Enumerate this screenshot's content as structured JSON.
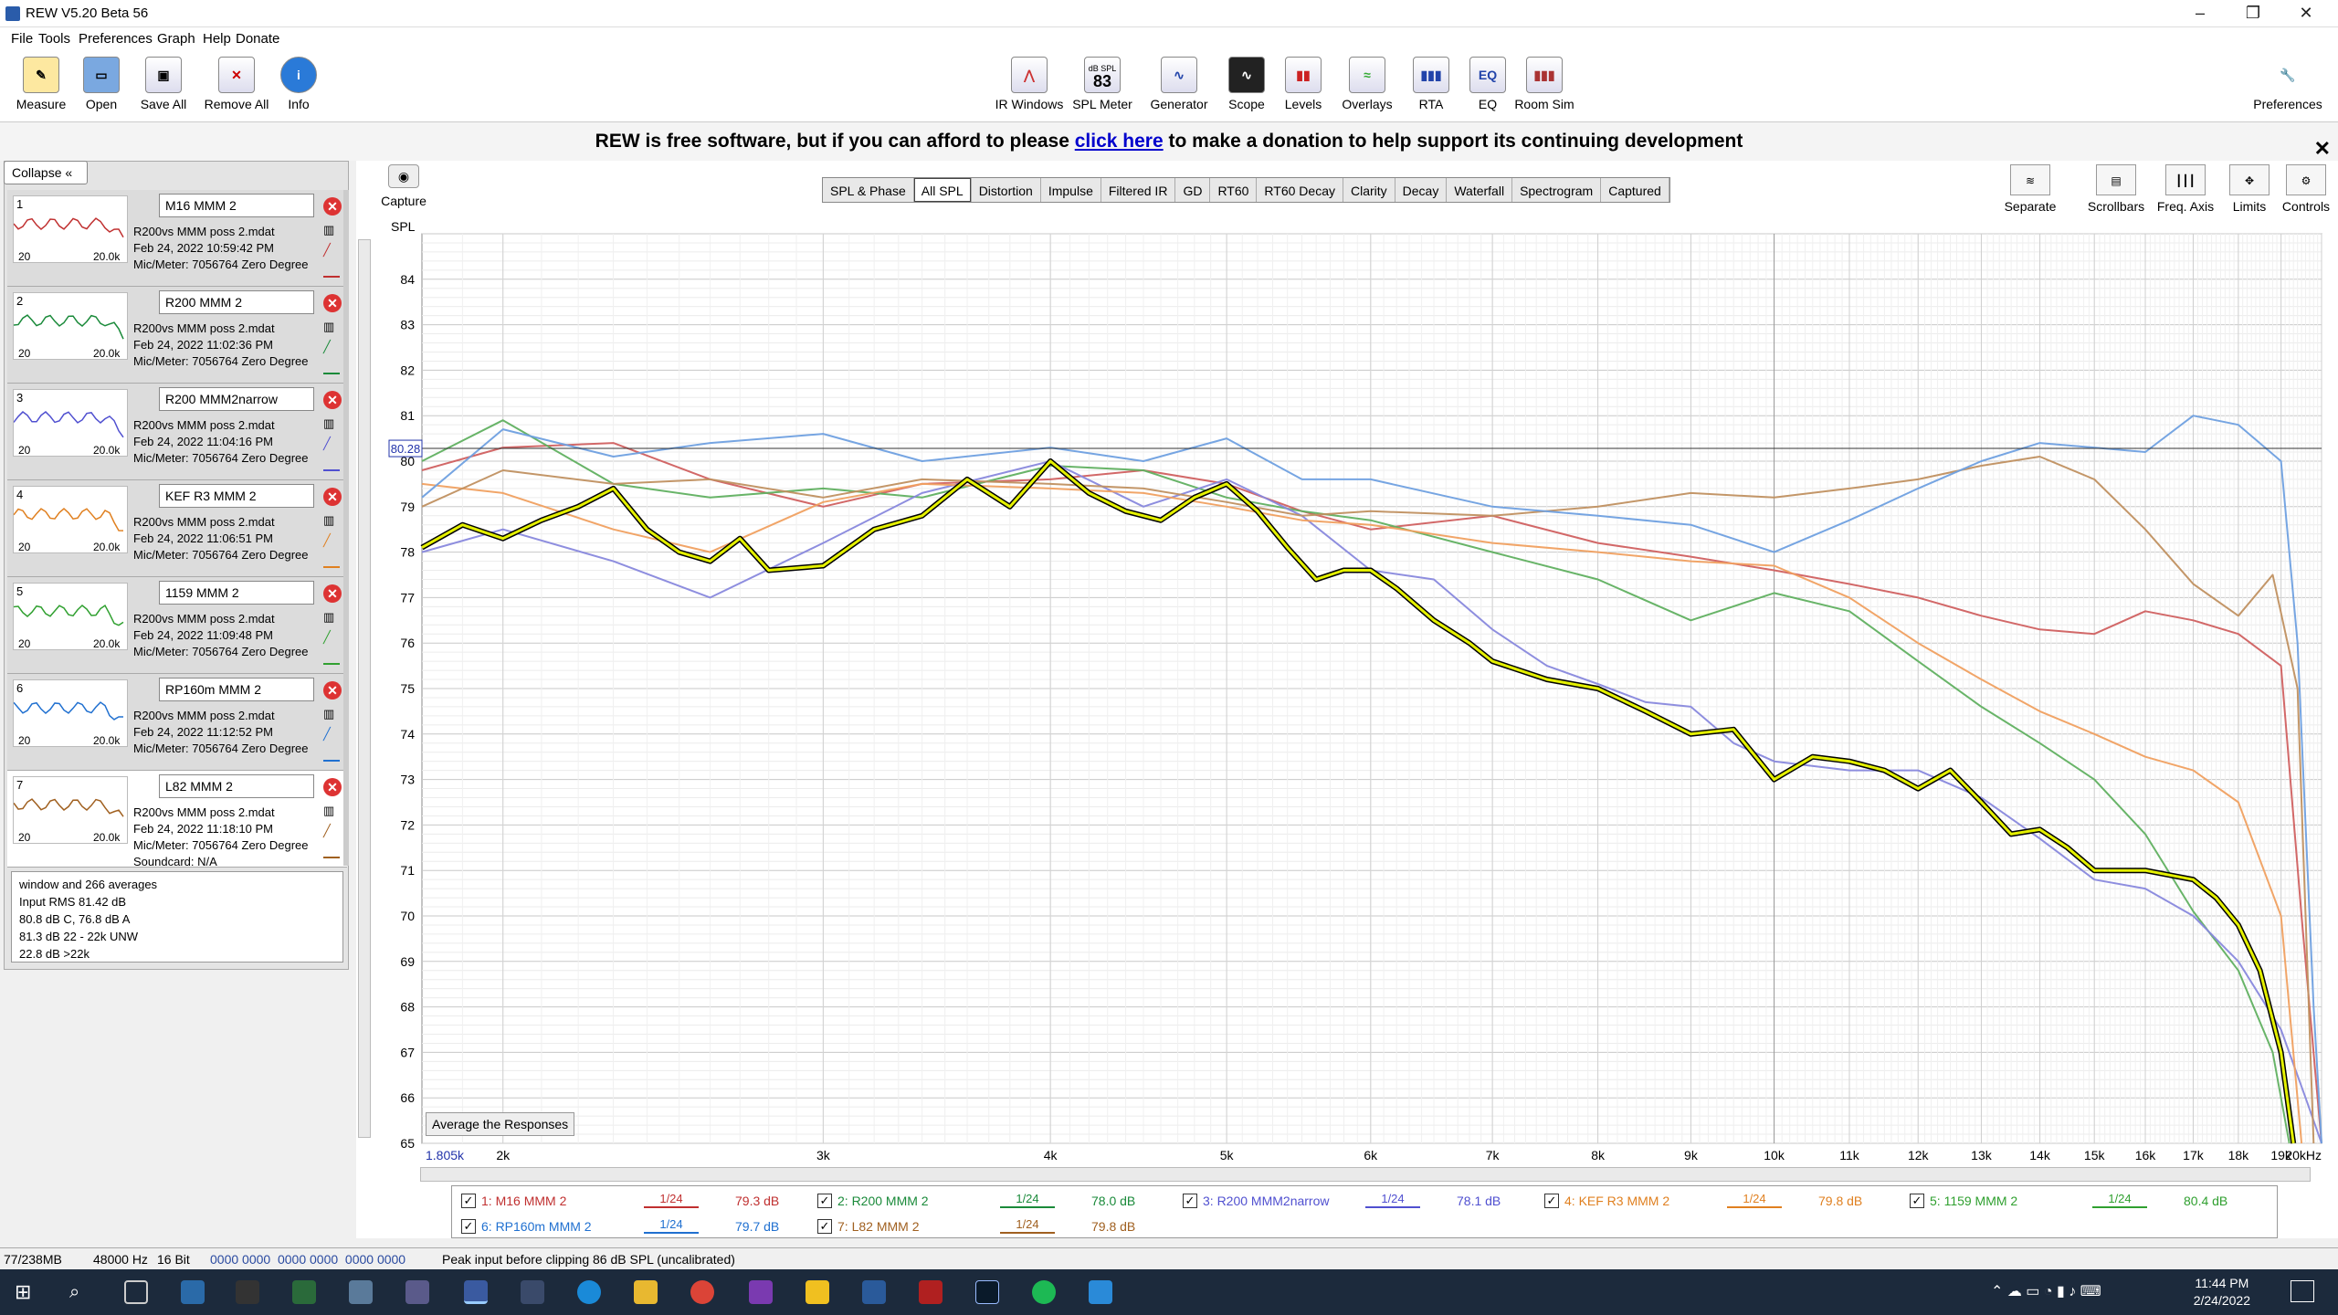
{
  "app": {
    "title": "REW V5.20 Beta 56"
  },
  "menu": [
    "File",
    "Tools",
    "Preferences",
    "Graph",
    "Help",
    "Donate"
  ],
  "toolbar_left": [
    "Measure",
    "Open",
    "Save All",
    "Remove All",
    "Info"
  ],
  "toolbar_center": [
    "IR Windows",
    "SPL Meter",
    "Generator",
    "Scope",
    "Levels",
    "Overlays",
    "RTA",
    "EQ",
    "Room Sim"
  ],
  "spl_meter_badge": {
    "top": "dB SPL",
    "value": "83"
  },
  "preferences_label": "Preferences",
  "banner": {
    "pre": "REW is free software, but if you can afford to please ",
    "link": "click here",
    "post": " to make a donation to help support its continuing development"
  },
  "collapse_label": "Collapse",
  "measurements": [
    {
      "num": "1",
      "name": "M16 MMM 2",
      "file": "R200vs MMM poss 2.mdat",
      "date": "Feb 24, 2022 10:59:42 PM",
      "mic": "Mic/Meter: 7056764 Zero Degree",
      "color": "#c03030"
    },
    {
      "num": "2",
      "name": "R200 MMM 2",
      "file": "R200vs MMM poss 2.mdat",
      "date": "Feb 24, 2022 11:02:36 PM",
      "mic": "Mic/Meter: 7056764 Zero Degree",
      "color": "#1a8a3a"
    },
    {
      "num": "3",
      "name": "R200 MMM2narrow",
      "file": "R200vs MMM poss 2.mdat",
      "date": "Feb 24, 2022 11:04:16 PM",
      "mic": "Mic/Meter: 7056764 Zero Degree",
      "color": "#5050d0"
    },
    {
      "num": "4",
      "name": "KEF R3 MMM 2",
      "file": "R200vs MMM poss 2.mdat",
      "date": "Feb 24, 2022 11:06:51 PM",
      "mic": "Mic/Meter: 7056764 Zero Degree",
      "color": "#e08020"
    },
    {
      "num": "5",
      "name": "1159 MMM 2",
      "file": "R200vs MMM poss 2.mdat",
      "date": "Feb 24, 2022 11:09:48 PM",
      "mic": "Mic/Meter: 7056764 Zero Degree",
      "color": "#30a030"
    },
    {
      "num": "6",
      "name": "RP160m MMM 2",
      "file": "R200vs MMM poss 2.mdat",
      "date": "Feb 24, 2022 11:12:52 PM",
      "mic": "Mic/Meter: 7056764 Zero Degree",
      "color": "#2070d0"
    },
    {
      "num": "7",
      "name": "L82 MMM 2",
      "file": "R200vs MMM poss 2.mdat",
      "date": "Feb 24, 2022 11:18:10 PM",
      "mic": "Mic/Meter: 7056764 Zero Degree",
      "color": "#a06020"
    }
  ],
  "thumb_axis": {
    "min": "20",
    "max": "20.0k"
  },
  "soundcard_line": "Soundcard: N/A",
  "info_lines": [
    "window and 266 averages",
    "Input RMS 81.42 dB",
    "80.8 dB C, 76.8 dB A",
    "81.3 dB 22 - 22k UNW",
    "22.8 dB >22k"
  ],
  "capture_label": "Capture",
  "graph_tabs": [
    "SPL & Phase",
    "All SPL",
    "Distortion",
    "Impulse",
    "Filtered IR",
    "GD",
    "RT60",
    "RT60 Decay",
    "Clarity",
    "Decay",
    "Waterfall",
    "Spectrogram",
    "Captured"
  ],
  "active_tab": "All SPL",
  "right_buttons": [
    "Separate",
    "Scrollbars",
    "Freq. Axis",
    "Limits",
    "Controls"
  ],
  "average_button": "Average the Responses",
  "chart_data": {
    "type": "line",
    "ylabel": "SPL",
    "ylim": [
      65,
      85
    ],
    "yticks": [
      "84",
      "83",
      "82",
      "81",
      "80",
      "79",
      "78",
      "77",
      "76",
      "75",
      "74",
      "73",
      "72",
      "71",
      "70",
      "69",
      "68",
      "67",
      "66",
      "65"
    ],
    "xscale": "log",
    "xlim": [
      1805,
      20000
    ],
    "xticks": [
      {
        "v": 2000,
        "t": "2k"
      },
      {
        "v": 3000,
        "t": "3k"
      },
      {
        "v": 4000,
        "t": "4k"
      },
      {
        "v": 5000,
        "t": "5k"
      },
      {
        "v": 6000,
        "t": "6k"
      },
      {
        "v": 7000,
        "t": "7k"
      },
      {
        "v": 8000,
        "t": "8k"
      },
      {
        "v": 9000,
        "t": "9k"
      },
      {
        "v": 10000,
        "t": "10k"
      },
      {
        "v": 11000,
        "t": "11k"
      },
      {
        "v": 12000,
        "t": "12k"
      },
      {
        "v": 13000,
        "t": "13k"
      },
      {
        "v": 14000,
        "t": "14k"
      },
      {
        "v": 15000,
        "t": "15k"
      },
      {
        "v": 16000,
        "t": "16k"
      },
      {
        "v": 17000,
        "t": "17k"
      },
      {
        "v": 18000,
        "t": "18k"
      },
      {
        "v": 19000,
        "t": "19k"
      },
      {
        "v": 20000,
        "t": "20kHz"
      }
    ],
    "x_start_label": "1.805k",
    "cursor_value": "80.28",
    "cursor_y": 80.28,
    "series": [
      {
        "name": "M16 MMM 2",
        "color": "#d06060",
        "x": [
          1805,
          2000,
          2300,
          2600,
          3000,
          3400,
          4000,
          4500,
          5000,
          5500,
          6000,
          7000,
          8000,
          9000,
          10000,
          11000,
          12000,
          13000,
          14000,
          15000,
          16000,
          17000,
          18000,
          19000,
          19500,
          20000
        ],
        "y": [
          79.8,
          80.3,
          80.4,
          79.6,
          79.0,
          79.5,
          79.6,
          79.8,
          79.5,
          78.9,
          78.5,
          78.8,
          78.2,
          77.9,
          77.6,
          77.3,
          77.0,
          76.6,
          76.3,
          76.2,
          76.7,
          76.5,
          76.2,
          75.5,
          70.0,
          65.0
        ]
      },
      {
        "name": "R200 MMM 2",
        "color": "#60b060",
        "x": [
          1805,
          2000,
          2300,
          2600,
          3000,
          3400,
          4000,
          4500,
          5000,
          5500,
          6000,
          7000,
          8000,
          9000,
          10000,
          11000,
          12000,
          13000,
          14000,
          15000,
          16000,
          17000,
          18000,
          18800,
          19200
        ],
        "y": [
          80.0,
          80.9,
          79.5,
          79.2,
          79.4,
          79.2,
          79.9,
          79.8,
          79.2,
          78.9,
          78.7,
          78.0,
          77.4,
          76.5,
          77.1,
          76.7,
          75.6,
          74.6,
          73.8,
          73.0,
          71.8,
          70.1,
          68.8,
          67.0,
          65.0
        ]
      },
      {
        "name": "R200 MMM2narrow",
        "color": "#8888dd",
        "x": [
          1805,
          2000,
          2300,
          2600,
          3000,
          3400,
          4000,
          4500,
          5000,
          5500,
          6000,
          6500,
          7000,
          7500,
          8000,
          8500,
          9000,
          9500,
          10000,
          11000,
          12000,
          13000,
          14000,
          15000,
          16000,
          17000,
          18000,
          19000,
          19600,
          20000
        ],
        "y": [
          78.0,
          78.5,
          77.8,
          77.0,
          78.2,
          79.3,
          80.0,
          79.0,
          79.6,
          78.8,
          77.6,
          77.4,
          76.3,
          75.5,
          75.1,
          74.7,
          74.6,
          73.8,
          73.4,
          73.2,
          73.2,
          72.6,
          71.7,
          70.8,
          70.6,
          70.0,
          69.0,
          67.5,
          66.0,
          65.0
        ]
      },
      {
        "name": "KEF R3 MMM 2",
        "color": "#f0a060",
        "x": [
          1805,
          2000,
          2300,
          2600,
          3000,
          3400,
          4000,
          4500,
          5000,
          5500,
          6000,
          7000,
          8000,
          9000,
          10000,
          11000,
          12000,
          13000,
          14000,
          15000,
          16000,
          17000,
          18000,
          19000,
          19500
        ],
        "y": [
          79.5,
          79.3,
          78.5,
          78.0,
          79.1,
          79.5,
          79.4,
          79.3,
          79.0,
          78.7,
          78.6,
          78.2,
          78.0,
          77.8,
          77.7,
          77.0,
          76.0,
          75.2,
          74.5,
          74.0,
          73.5,
          73.2,
          72.5,
          70.0,
          65.0
        ]
      },
      {
        "name": "1159 MMM 2",
        "color": "#c09060",
        "x": [
          1805,
          2000,
          2300,
          2600,
          3000,
          3400,
          4000,
          4500,
          5000,
          5500,
          6000,
          7000,
          8000,
          9000,
          10000,
          11000,
          12000,
          13000,
          14000,
          15000,
          16000,
          17000,
          18000,
          18800,
          19400,
          19800
        ],
        "y": [
          79.0,
          79.8,
          79.5,
          79.6,
          79.2,
          79.6,
          79.5,
          79.4,
          79.1,
          78.8,
          78.9,
          78.8,
          79.0,
          79.3,
          79.2,
          79.4,
          79.6,
          79.9,
          80.1,
          79.6,
          78.5,
          77.3,
          76.6,
          77.5,
          75.0,
          65.0
        ]
      },
      {
        "name": "RP160m MMM 2",
        "color": "#6fa0e0",
        "x": [
          1805,
          2000,
          2300,
          2600,
          3000,
          3400,
          4000,
          4500,
          5000,
          5500,
          6000,
          7000,
          8000,
          9000,
          10000,
          11000,
          12000,
          13000,
          14000,
          15000,
          16000,
          17000,
          18000,
          19000,
          19400,
          19800,
          20000
        ],
        "y": [
          79.2,
          80.7,
          80.1,
          80.4,
          80.6,
          80.0,
          80.3,
          80.0,
          80.5,
          79.6,
          79.6,
          79.0,
          78.8,
          78.6,
          78.0,
          78.7,
          79.4,
          80.0,
          80.4,
          80.3,
          80.2,
          81.0,
          80.8,
          80.0,
          76.0,
          68.0,
          65.0
        ]
      },
      {
        "name": "L82 MMM 2",
        "color": "#e4f000",
        "x": [
          1805,
          1900,
          2000,
          2100,
          2200,
          2300,
          2400,
          2500,
          2600,
          2700,
          2800,
          3000,
          3200,
          3400,
          3600,
          3800,
          4000,
          4200,
          4400,
          4600,
          4800,
          5000,
          5200,
          5400,
          5600,
          5800,
          6000,
          6200,
          6500,
          6800,
          7000,
          7500,
          8000,
          8500,
          9000,
          9500,
          10000,
          10500,
          11000,
          11500,
          12000,
          12500,
          13000,
          13500,
          14000,
          14500,
          15000,
          16000,
          17000,
          17500,
          18000,
          18500,
          19000,
          19300
        ],
        "y": [
          78.1,
          78.6,
          78.3,
          78.7,
          79.0,
          79.4,
          78.5,
          78.0,
          77.8,
          78.3,
          77.6,
          77.7,
          78.5,
          78.8,
          79.6,
          79.0,
          80.0,
          79.3,
          78.9,
          78.7,
          79.2,
          79.5,
          78.9,
          78.1,
          77.4,
          77.6,
          77.6,
          77.2,
          76.5,
          76.0,
          75.6,
          75.2,
          75.0,
          74.5,
          74.0,
          74.1,
          73.0,
          73.5,
          73.4,
          73.2,
          72.8,
          73.2,
          72.5,
          71.8,
          71.9,
          71.5,
          71.0,
          71.0,
          70.8,
          70.4,
          69.8,
          68.8,
          67.0,
          65.0
        ]
      }
    ]
  },
  "legend": [
    {
      "label": "1: M16 MMM 2",
      "smoothing": "1/24",
      "value": "79.3 dB",
      "color": "#c03030"
    },
    {
      "label": "2: R200 MMM 2",
      "smoothing": "1/24",
      "value": "78.0 dB",
      "color": "#1a8a3a"
    },
    {
      "label": "3: R200 MMM2narrow",
      "smoothing": "1/24",
      "value": "78.1 dB",
      "color": "#5050d0"
    },
    {
      "label": "4: KEF R3 MMM 2",
      "smoothing": "1/24",
      "value": "79.8 dB",
      "color": "#e08020"
    },
    {
      "label": "5: 1159 MMM 2",
      "smoothing": "1/24",
      "value": "80.4 dB",
      "color": "#30a030"
    },
    {
      "label": "6: RP160m MMM 2",
      "smoothing": "1/24",
      "value": "79.7 dB",
      "color": "#2070d0"
    },
    {
      "label": "7: L82 MMM 2",
      "smoothing": "1/24",
      "value": "79.8 dB",
      "color": "#a06020"
    }
  ],
  "status": {
    "memory": "77/238MB",
    "rate": "48000 Hz",
    "bits": "16 Bit",
    "bits_display": "0000 0000  0000 0000  0000 0000",
    "message": "Peak input before clipping 86 dB SPL (uncalibrated)"
  },
  "clock": {
    "time": "11:44 PM",
    "date": "2/24/2022"
  }
}
